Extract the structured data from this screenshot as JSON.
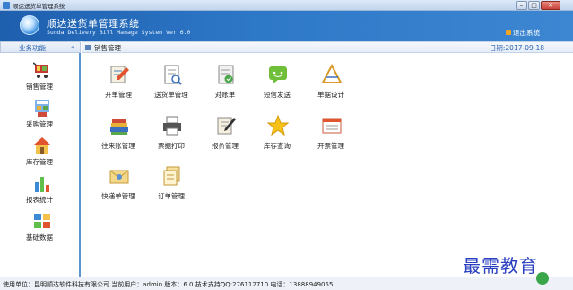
{
  "window": {
    "title": "顺达送货单管理系统",
    "controls": {
      "minimize": "–",
      "maximize": "□",
      "close": "✕"
    }
  },
  "banner": {
    "title_cn": "顺达送货单管理系统",
    "title_en": "Sunda Delivery Bill Manage System Ver 6.0",
    "logout_label": "退出系统",
    "logo_icon": "globe-logo-icon"
  },
  "sidebar": {
    "header": "业务功能",
    "collapse": "«",
    "items": [
      {
        "label": "销售管理",
        "icon": "shopping-cart-icon"
      },
      {
        "label": "采购管理",
        "icon": "purchase-icon"
      },
      {
        "label": "库存管理",
        "icon": "warehouse-icon"
      },
      {
        "label": "报表统计",
        "icon": "bar-chart-icon"
      },
      {
        "label": "基础数据",
        "icon": "data-blocks-icon"
      }
    ]
  },
  "content": {
    "header": "销售管理",
    "date": "日期:2017-09-18",
    "tiles": [
      {
        "label": "开单管理",
        "icon": "form-edit-icon"
      },
      {
        "label": "送货单管理",
        "icon": "delivery-doc-icon"
      },
      {
        "label": "对账单",
        "icon": "statement-check-icon"
      },
      {
        "label": "短信发送",
        "icon": "sms-bubble-icon"
      },
      {
        "label": "单据设计",
        "icon": "design-tool-icon"
      },
      {
        "label": "往来账管理",
        "icon": "ledger-books-icon"
      },
      {
        "label": "票据打印",
        "icon": "printer-icon"
      },
      {
        "label": "报价管理",
        "icon": "quote-doc-icon"
      },
      {
        "label": "库存查询",
        "icon": "star-icon"
      },
      {
        "label": "开票管理",
        "icon": "invoice-window-icon"
      },
      {
        "label": "快递单管理",
        "icon": "envelope-icon"
      },
      {
        "label": "订单管理",
        "icon": "order-docs-icon"
      }
    ]
  },
  "statusbar": {
    "text": "使用单位：昆明顺达软件科技有限公司   当前用户：admin  版本：6.0  技术支持QQ:276112710    电话：13888949055"
  },
  "watermark": "最需教育",
  "colors": {
    "banner": "#2e78c8",
    "sidebar_border": "#5b93d3",
    "accent_text": "#2b63b0"
  }
}
